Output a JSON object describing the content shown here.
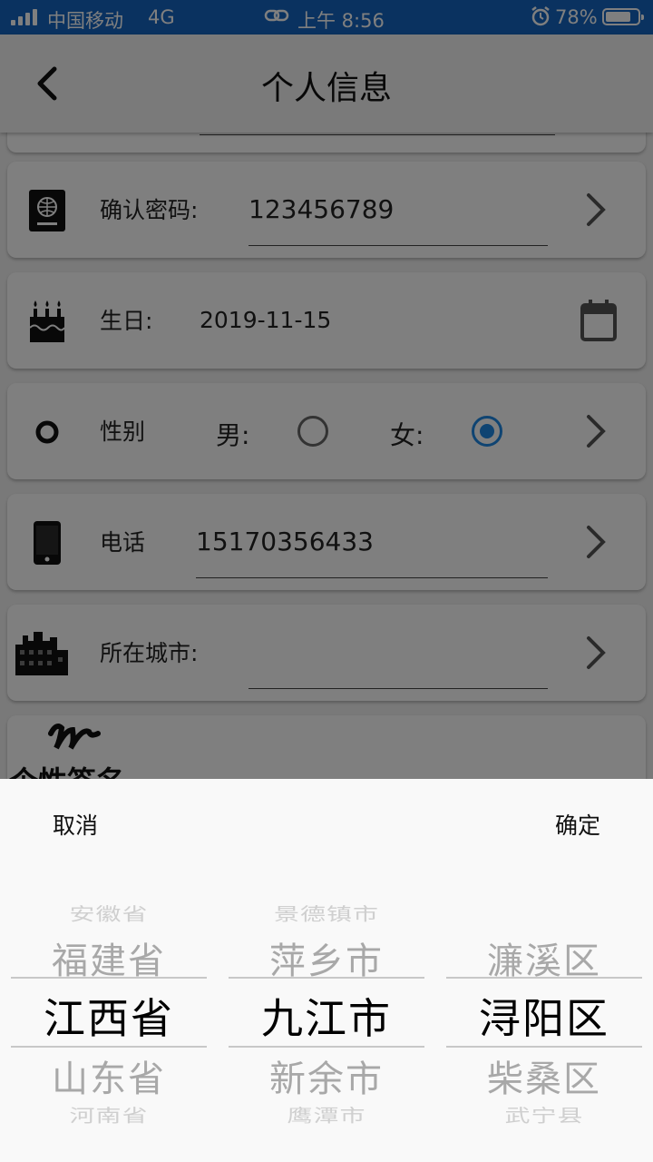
{
  "status_bar": {
    "carrier": "中国移动",
    "network": "4G",
    "time": "上午 8:56",
    "battery_percent": "78%",
    "battery_level": 0.78
  },
  "header": {
    "title": "个人信息"
  },
  "form": {
    "confirm_password_label": "确认密码:",
    "confirm_password_value": "123456789",
    "birthday_label": "生日:",
    "birthday_value": "2019-11-15",
    "gender_label": "性别",
    "gender_male_label": "男:",
    "gender_female_label": "女:",
    "gender_selected": "女",
    "phone_label": "电话",
    "phone_value": "15170356433",
    "city_label": "所在城市:",
    "city_value": "",
    "signature_label": "个性签名"
  },
  "picker": {
    "cancel_label": "取消",
    "confirm_label": "确定",
    "provinces": [
      "安徽省",
      "福建省",
      "江西省",
      "山东省",
      "河南省"
    ],
    "cities": [
      "景德镇市",
      "萍乡市",
      "九江市",
      "新余市",
      "鹰潭市"
    ],
    "districts": [
      "",
      "濂溪区",
      "浔阳区",
      "柴桑区",
      "武宁县"
    ],
    "selected": {
      "province": "江西省",
      "city": "九江市",
      "district": "浔阳区"
    }
  },
  "colors": {
    "status_bar": "#1565c0",
    "accent": "#1e88e5",
    "overlay": "rgba(0,0,0,0.5)"
  }
}
